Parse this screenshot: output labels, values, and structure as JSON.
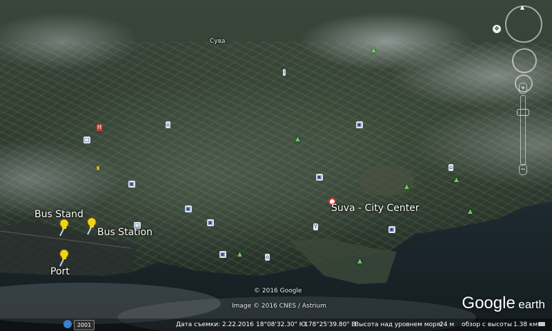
{
  "map": {
    "region_label": "Сува",
    "city_center_label": "Suva - City Center",
    "placemarks": [
      {
        "name": "Bus Stand"
      },
      {
        "name": "Bus Station"
      },
      {
        "name": "Port"
      }
    ]
  },
  "credits": {
    "copyright": "© 2016 Google",
    "imagery": "Image © 2016 CNES / Astrium"
  },
  "logo": {
    "google": "Google",
    "earth": "earth"
  },
  "statusbar": {
    "historical_year": "2001",
    "capture_date": "Дата съемки: 2.22.2016",
    "latitude": "18°08'32.30\" Ю",
    "longitude": "178°25'39.80\" В",
    "elevation_label": "Высота над уровнем моря:",
    "elevation_value": "24 м",
    "eye_alt_label": "обзор с высоты",
    "eye_alt_value": "1.38 км"
  },
  "colors": {
    "pin": "#f2d21c",
    "tree_icon": "#5fd35f",
    "center_marker": "#e02a2a"
  }
}
